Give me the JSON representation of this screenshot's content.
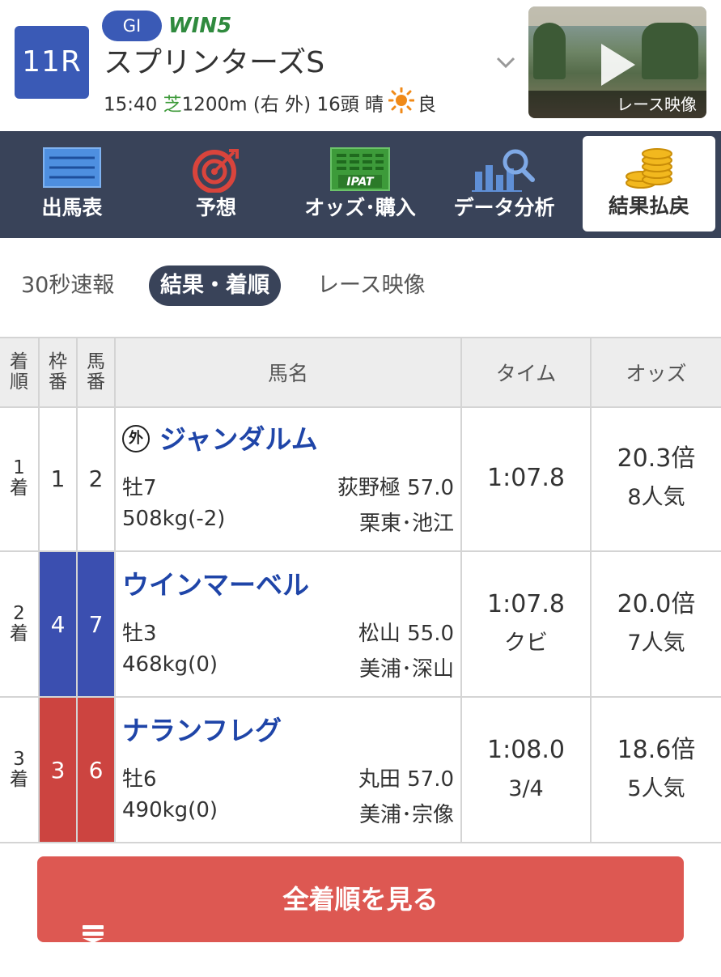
{
  "header": {
    "race_number": "11R",
    "grade": "GI",
    "win5": "WIN5",
    "race_name": "スプリンターズS",
    "time": "15:40",
    "surface": "芝",
    "distance": "1200m",
    "course": "(右 外)",
    "runners": "16頭",
    "weather": "晴",
    "track_condition": "良",
    "video_label": "レース映像"
  },
  "nav": [
    {
      "label": "出馬表",
      "icon": "entry-table-icon"
    },
    {
      "label": "予想",
      "icon": "target-icon"
    },
    {
      "label": "オッズ･購入",
      "icon": "ipat-icon"
    },
    {
      "label": "データ分析",
      "icon": "data-analysis-icon"
    },
    {
      "label": "結果払戻",
      "icon": "coins-icon",
      "active": true
    }
  ],
  "tabs": {
    "flash": "30秒速報",
    "result": "結果・着順",
    "video": "レース映像"
  },
  "table": {
    "headers": {
      "rank": "着順",
      "waku": "枠番",
      "umaban": "馬番",
      "name": "馬名",
      "time": "タイム",
      "odds": "オッズ"
    },
    "rows": [
      {
        "rank": "1着",
        "waku": "1",
        "umaban": "2",
        "foreign": "外",
        "name": "ジャンダルム",
        "sexage": "牡7",
        "jockey": "荻野極 57.0",
        "weight": "508kg(-2)",
        "trainer": "栗東･池江",
        "time": "1:07.8",
        "margin": "",
        "odds": "20.3倍",
        "popularity": "8人気"
      },
      {
        "rank": "2着",
        "waku": "4",
        "umaban": "7",
        "name": "ウインマーベル",
        "sexage": "牡3",
        "jockey": "松山 55.0",
        "weight": "468kg(0)",
        "trainer": "美浦･深山",
        "time": "1:07.8",
        "margin": "クビ",
        "odds": "20.0倍",
        "popularity": "7人気"
      },
      {
        "rank": "3着",
        "waku": "3",
        "umaban": "6",
        "name": "ナランフレグ",
        "sexage": "牡6",
        "jockey": "丸田 57.0",
        "weight": "490kg(0)",
        "trainer": "美浦･宗像",
        "time": "1:08.0",
        "margin": "3/4",
        "odds": "18.6倍",
        "popularity": "5人気"
      }
    ]
  },
  "button": {
    "all_results": "全着順を見る"
  },
  "colors": {
    "primary_blue": "#3a5ab6",
    "nav_bg": "#394359",
    "waku_4": "#3b4fb0",
    "waku_3": "#cc4440",
    "button_red": "#dd5852",
    "horse_name": "#1f45a8",
    "turf_green": "#3e9a3a"
  }
}
